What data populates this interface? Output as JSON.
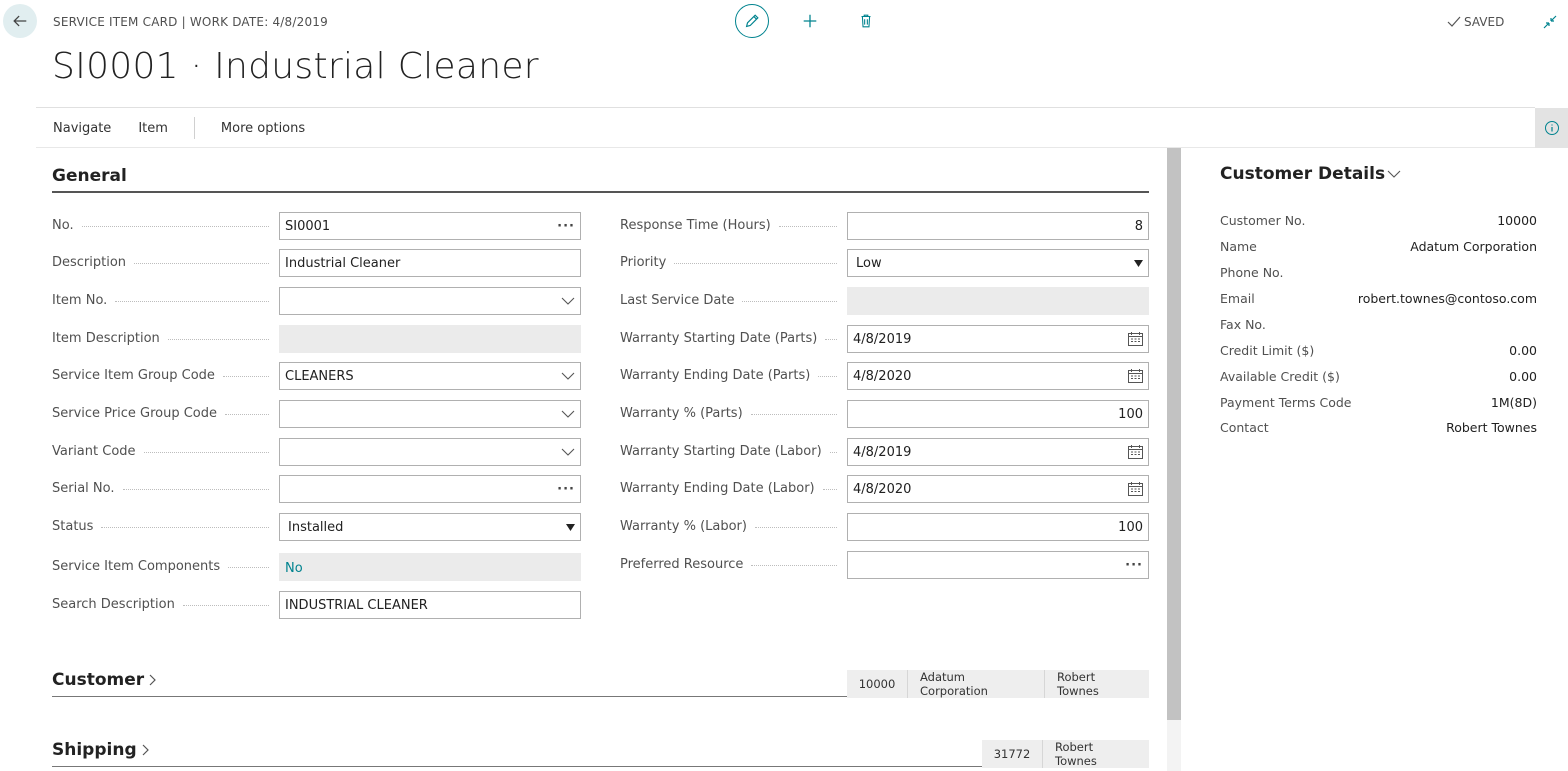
{
  "header": {
    "caption": "SERVICE ITEM CARD | WORK DATE: 4/8/2019",
    "title": "SI0001 · Industrial Cleaner",
    "saved_label": "SAVED"
  },
  "action_bar": {
    "items": [
      "Navigate",
      "Item"
    ],
    "more": "More options"
  },
  "general": {
    "title": "General",
    "left_fields": [
      {
        "label": "No.",
        "value": "SI0001",
        "type": "lookup"
      },
      {
        "label": "Description",
        "value": "Industrial Cleaner",
        "type": "text"
      },
      {
        "label": "Item No.",
        "value": "",
        "type": "dropdown"
      },
      {
        "label": "Item Description",
        "value": "",
        "type": "readonly"
      },
      {
        "label": "Service Item Group Code",
        "value": "CLEANERS",
        "type": "dropdown"
      },
      {
        "label": "Service Price Group Code",
        "value": "",
        "type": "dropdown"
      },
      {
        "label": "Variant Code",
        "value": "",
        "type": "dropdown"
      },
      {
        "label": "Serial No.",
        "value": "",
        "type": "lookup"
      },
      {
        "label": "Status",
        "value": "Installed",
        "type": "select"
      },
      {
        "label": "Service Item Components",
        "value": "No",
        "type": "readonly-link"
      },
      {
        "label": "Search Description",
        "value": "INDUSTRIAL CLEANER",
        "type": "text"
      }
    ],
    "right_fields": [
      {
        "label": "Response Time (Hours)",
        "value": "8",
        "type": "number"
      },
      {
        "label": "Priority",
        "value": "Low",
        "type": "select"
      },
      {
        "label": "Last Service Date",
        "value": "",
        "type": "readonly"
      },
      {
        "label": "Warranty Starting Date (Parts)",
        "value": "4/8/2019",
        "type": "date"
      },
      {
        "label": "Warranty Ending Date (Parts)",
        "value": "4/8/2020",
        "type": "date"
      },
      {
        "label": "Warranty % (Parts)",
        "value": "100",
        "type": "number"
      },
      {
        "label": "Warranty Starting Date (Labor)",
        "value": "4/8/2019",
        "type": "date"
      },
      {
        "label": "Warranty Ending Date (Labor)",
        "value": "4/8/2020",
        "type": "date"
      },
      {
        "label": "Warranty % (Labor)",
        "value": "100",
        "type": "number"
      },
      {
        "label": "Preferred Resource",
        "value": "",
        "type": "lookup"
      }
    ]
  },
  "customer_section": {
    "title": "Customer",
    "summary": [
      "10000",
      "Adatum Corporation",
      "Robert Townes"
    ]
  },
  "shipping_section": {
    "title": "Shipping",
    "summary": [
      "31772",
      "Robert Townes"
    ]
  },
  "factbox": {
    "title": "Customer Details",
    "rows": [
      {
        "label": "Customer No.",
        "value": "10000",
        "link": true
      },
      {
        "label": "Name",
        "value": "Adatum Corporation",
        "link": false
      },
      {
        "label": "Phone No.",
        "value": "",
        "link": false
      },
      {
        "label": "Email",
        "value": "robert.townes@contoso.com",
        "link": true
      },
      {
        "label": "Fax No.",
        "value": "",
        "link": false
      },
      {
        "label": "Credit Limit ($)",
        "value": "0.00",
        "link": false
      },
      {
        "label": "Available Credit ($)",
        "value": "0.00",
        "link": true
      },
      {
        "label": "Payment Terms Code",
        "value": "1M(8D)",
        "link": false
      },
      {
        "label": "Contact",
        "value": "Robert Townes",
        "link": false
      }
    ]
  },
  "colors": {
    "accent": "#00838f",
    "readonly_bg": "#ebebeb",
    "back_button_bg": "#e1eef0"
  },
  "icons": {
    "back": "arrow-left-icon",
    "edit": "pencil-icon",
    "new": "plus-icon",
    "delete": "trash-icon",
    "saved": "checkmark-icon",
    "collapse": "collapse-arrows-icon",
    "info": "info-icon",
    "lookup": "ellipsis-icon",
    "dropdown": "chevron-down-icon",
    "select": "triangle-down-icon",
    "date": "calendar-icon"
  }
}
